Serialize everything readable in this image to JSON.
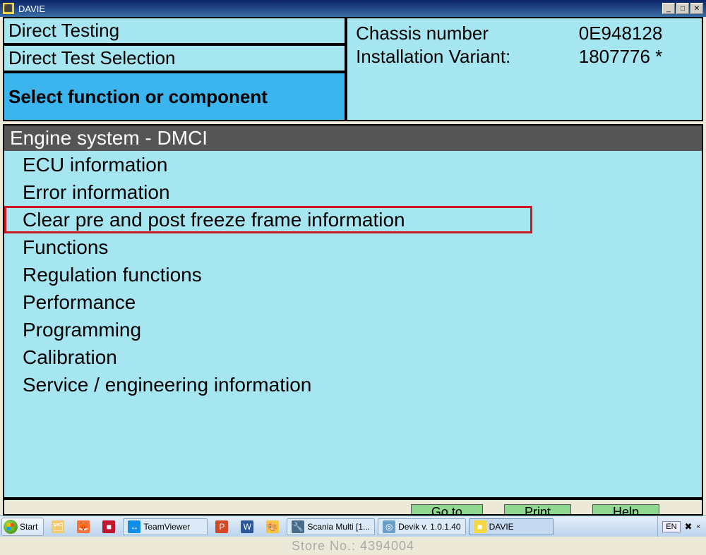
{
  "window": {
    "title": "DAVIE"
  },
  "header": {
    "line1": "Direct Testing",
    "line2": "Direct Test Selection",
    "prompt": "Select function or component",
    "chassis_label": "Chassis number",
    "chassis_value": "0E948128",
    "variant_label": "Installation Variant:",
    "variant_value": "1807776 *"
  },
  "list": {
    "group": "Engine system - DMCI",
    "items": [
      "ECU information",
      "Error information",
      "Clear pre and post freeze frame information",
      "Functions",
      "Regulation functions",
      "Performance",
      "Programming",
      "Calibration",
      "Service / engineering information"
    ],
    "highlighted_index": 2
  },
  "bottom": {
    "goto": "Go to",
    "print": "Print",
    "help": "Help"
  },
  "taskbar": {
    "start": "Start",
    "items": [
      {
        "label": "",
        "icon": "explorer"
      },
      {
        "label": "",
        "icon": "firefox"
      },
      {
        "label": "",
        "icon": "red"
      },
      {
        "label": "TeamViewer",
        "icon": "teamviewer"
      },
      {
        "label": "",
        "icon": "powerpoint"
      },
      {
        "label": "",
        "icon": "word"
      },
      {
        "label": "",
        "icon": "paint"
      },
      {
        "label": "Scania Multi  [1...",
        "icon": "scania"
      },
      {
        "label": "Devik v. 1.0.1.40",
        "icon": "devik"
      },
      {
        "label": "DAVIE",
        "icon": "davie",
        "active": true
      }
    ],
    "lang": "EN"
  },
  "watermark": "Store No.: 4394004"
}
